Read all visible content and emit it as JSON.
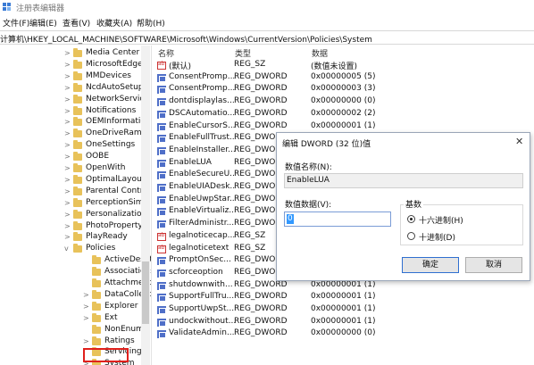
{
  "window": {
    "title": "注册表编辑器",
    "icon": "registry-editor-icon"
  },
  "menu": [
    "文件(F)",
    "编辑(E)",
    "查看(V)",
    "收藏夹(A)",
    "帮助(H)"
  ],
  "address": "计算机\\HKEY_LOCAL_MACHINE\\SOFTWARE\\Microsoft\\Windows\\CurrentVersion\\Policies\\System",
  "tree": [
    {
      "label": "Media Center",
      "expand": ">"
    },
    {
      "label": "MicrosoftEdge",
      "expand": ">"
    },
    {
      "label": "MMDevices",
      "expand": ">"
    },
    {
      "label": "NcdAutoSetup",
      "expand": ">"
    },
    {
      "label": "NetworkServic",
      "expand": ">"
    },
    {
      "label": "Notifications",
      "expand": ">"
    },
    {
      "label": "OEMInformatic",
      "expand": ">"
    },
    {
      "label": "OneDriveRamp",
      "expand": ">"
    },
    {
      "label": "OneSettings",
      "expand": ">"
    },
    {
      "label": "OOBE",
      "expand": ">"
    },
    {
      "label": "OpenWith",
      "expand": ">"
    },
    {
      "label": "OptimalLayout",
      "expand": ">"
    },
    {
      "label": "Parental Contro",
      "expand": ">"
    },
    {
      "label": "PerceptionSim",
      "expand": ">"
    },
    {
      "label": "Personalization",
      "expand": ">"
    },
    {
      "label": "PhotoProperty",
      "expand": ">"
    },
    {
      "label": "PlayReady",
      "expand": ">"
    },
    {
      "label": "Policies",
      "expand": "v"
    },
    {
      "label": "ActiveDeskt",
      "expand": ""
    },
    {
      "label": "Associations",
      "expand": ""
    },
    {
      "label": "Attachment",
      "expand": ""
    },
    {
      "label": "DataCollecti",
      "expand": ">"
    },
    {
      "label": "Explorer",
      "expand": ">"
    },
    {
      "label": "Ext",
      "expand": ">"
    },
    {
      "label": "NonEnum",
      "expand": ""
    },
    {
      "label": "Ratings",
      "expand": ">"
    },
    {
      "label": "Servicing",
      "expand": ""
    },
    {
      "label": "System",
      "expand": ">"
    }
  ],
  "list": {
    "headers": {
      "name": "名称",
      "type": "类型",
      "data": "数据"
    },
    "rows": [
      {
        "name": "(默认)",
        "type": "REG_SZ",
        "data": "(数值未设置)",
        "icon": "sz"
      },
      {
        "name": "ConsentPromp...",
        "type": "REG_DWORD",
        "data": "0x00000005 (5)",
        "icon": "dw"
      },
      {
        "name": "ConsentPromp...",
        "type": "REG_DWORD",
        "data": "0x00000003 (3)",
        "icon": "dw"
      },
      {
        "name": "dontdisplaylas...",
        "type": "REG_DWORD",
        "data": "0x00000000 (0)",
        "icon": "dw"
      },
      {
        "name": "DSCAutomatio...",
        "type": "REG_DWORD",
        "data": "0x00000002 (2)",
        "icon": "dw"
      },
      {
        "name": "EnableCursorS...",
        "type": "REG_DWORD",
        "data": "0x00000001 (1)",
        "icon": "dw"
      },
      {
        "name": "EnableFullTrust...",
        "type": "REG_DWORD",
        "data": "",
        "icon": "dw"
      },
      {
        "name": "EnableInstaller...",
        "type": "REG_DWORD",
        "data": "",
        "icon": "dw"
      },
      {
        "name": "EnableLUA",
        "type": "REG_DWORD",
        "data": "",
        "icon": "dw"
      },
      {
        "name": "EnableSecureU...",
        "type": "REG_DWORD",
        "data": "",
        "icon": "dw"
      },
      {
        "name": "EnableUIADesk...",
        "type": "REG_DWORD",
        "data": "",
        "icon": "dw"
      },
      {
        "name": "EnableUwpStar...",
        "type": "REG_DWORD",
        "data": "",
        "icon": "dw"
      },
      {
        "name": "EnableVirtualiz...",
        "type": "REG_DWORD",
        "data": "",
        "icon": "dw"
      },
      {
        "name": "FilterAdministr...",
        "type": "REG_DWORD",
        "data": "",
        "icon": "dw"
      },
      {
        "name": "legalnoticecap...",
        "type": "REG_SZ",
        "data": "",
        "icon": "sz"
      },
      {
        "name": "legalnoticetext",
        "type": "REG_SZ",
        "data": "",
        "icon": "sz"
      },
      {
        "name": "PromptOnSec...",
        "type": "REG_DWORD",
        "data": "",
        "icon": "dw"
      },
      {
        "name": "scforceoption",
        "type": "REG_DWORD",
        "data": "",
        "icon": "dw"
      },
      {
        "name": "shutdownwith...",
        "type": "REG_DWORD",
        "data": "0x00000001 (1)",
        "icon": "dw"
      },
      {
        "name": "SupportFullTru...",
        "type": "REG_DWORD",
        "data": "0x00000001 (1)",
        "icon": "dw"
      },
      {
        "name": "SupportUwpSt...",
        "type": "REG_DWORD",
        "data": "0x00000001 (1)",
        "icon": "dw"
      },
      {
        "name": "undockwithout...",
        "type": "REG_DWORD",
        "data": "0x00000001 (1)",
        "icon": "dw"
      },
      {
        "name": "ValidateAdmin...",
        "type": "REG_DWORD",
        "data": "0x00000000 (0)",
        "icon": "dw"
      }
    ]
  },
  "dialog": {
    "title": "编辑 DWORD (32 位)值",
    "close": "✕",
    "name_label": "数值名称(N):",
    "name_value": "EnableLUA",
    "data_label": "数值数据(V):",
    "data_value": "0",
    "base_label": "基数",
    "radio_hex": "十六进制(H)",
    "radio_dec": "十进制(D)",
    "ok": "确定",
    "cancel": "取消"
  },
  "colors": {
    "highlight": "#e0201c",
    "selection": "#3399ff",
    "folder": "#e8c25a",
    "dword_icon": "#4f6fc8"
  }
}
